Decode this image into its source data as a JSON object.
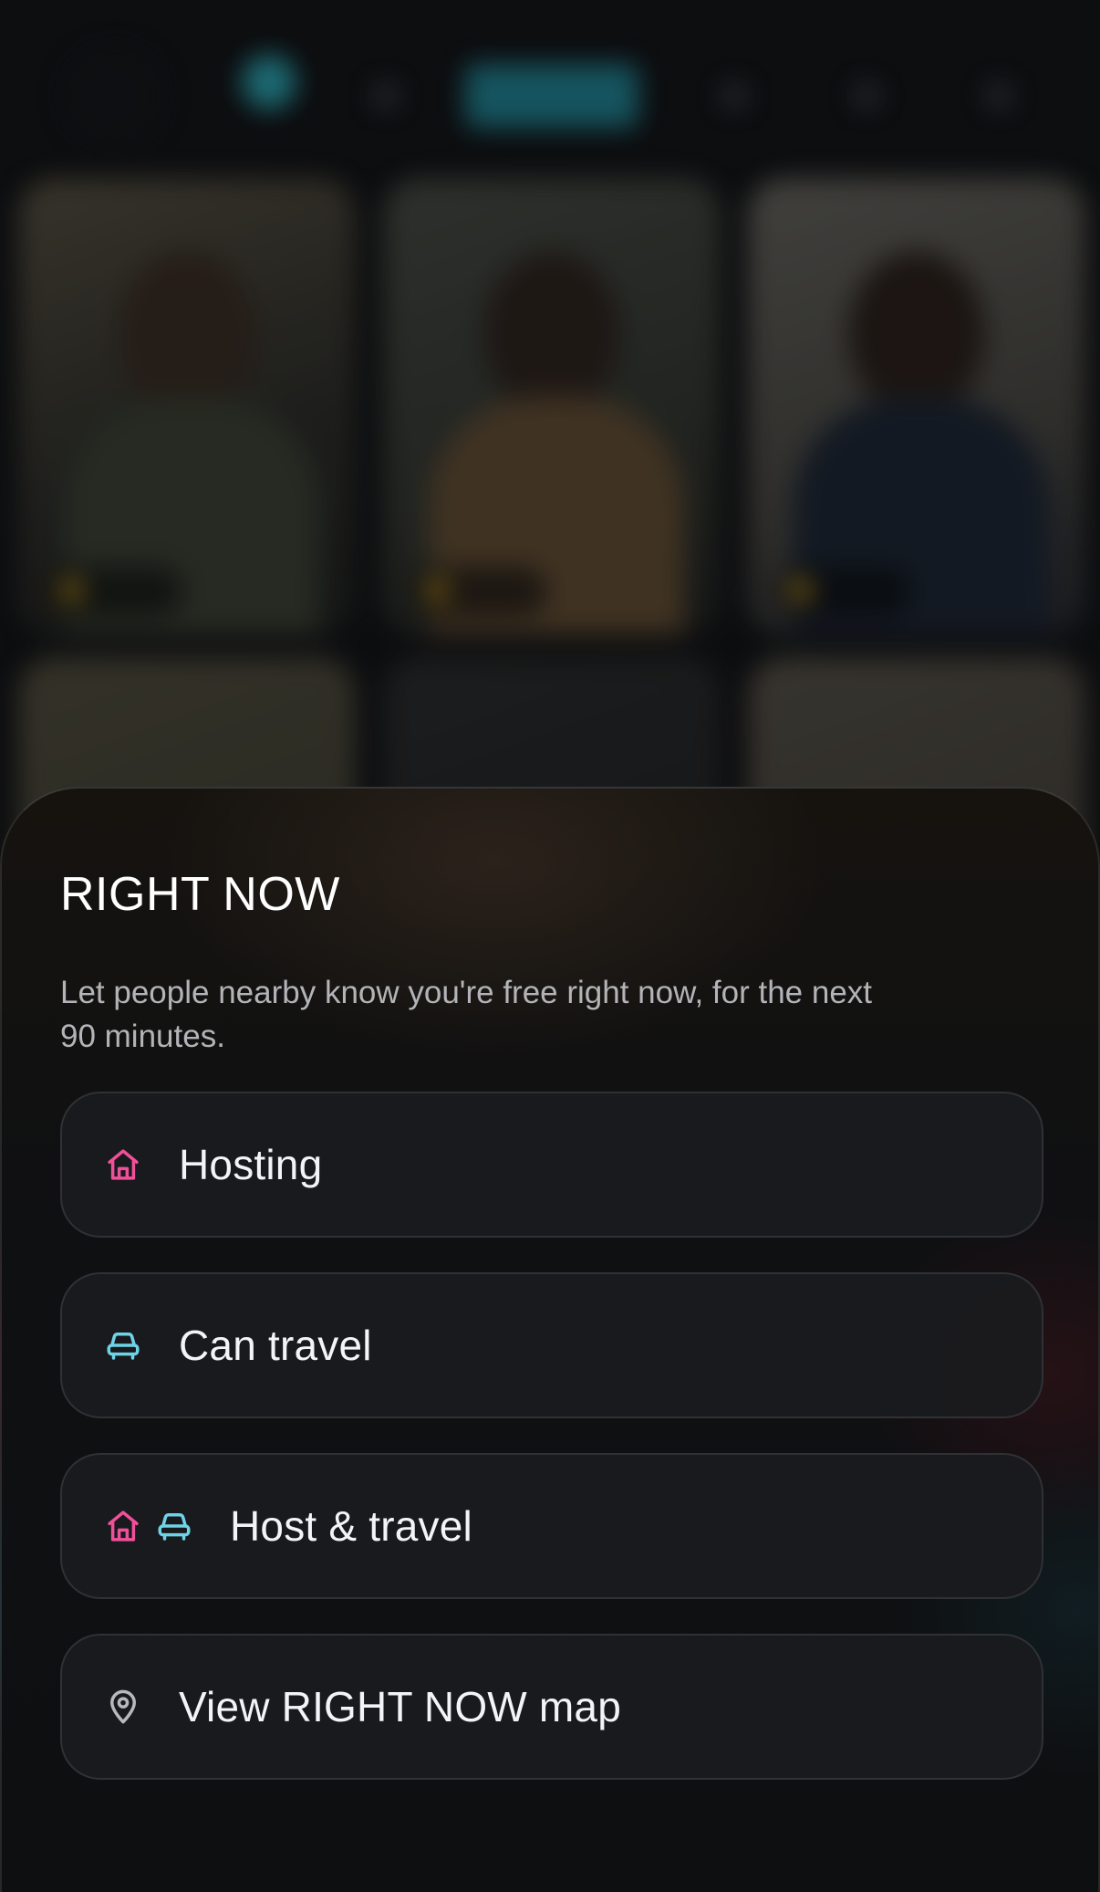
{
  "colors": {
    "host_accent": "#f0509a",
    "travel_accent": "#6fd3e8",
    "map_icon": "#b8b9bd",
    "sheet_background": "#0f1012"
  },
  "sheet": {
    "title": "RIGHT NOW",
    "description": "Let people nearby know you're free right now, for the next 90 minutes.",
    "options": [
      {
        "label": "Hosting",
        "icons": [
          "house-icon"
        ]
      },
      {
        "label": "Can travel",
        "icons": [
          "car-icon"
        ]
      },
      {
        "label": "Host & travel",
        "icons": [
          "house-icon",
          "car-icon"
        ]
      },
      {
        "label": "View RIGHT NOW map",
        "icons": [
          "map-pin-icon"
        ]
      }
    ]
  }
}
